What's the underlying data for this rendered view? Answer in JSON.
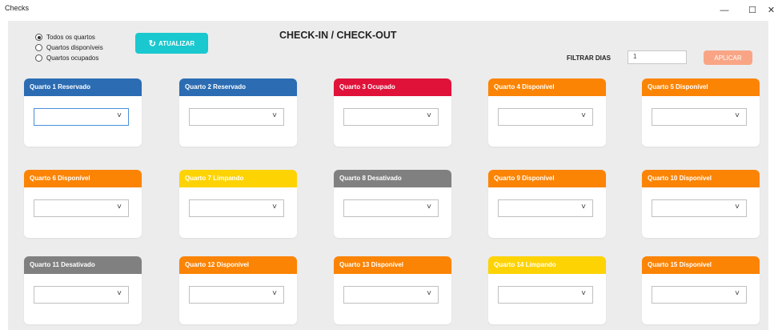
{
  "window": {
    "title": "Checks",
    "minimize": "—",
    "maximize": "☐",
    "close": "✕"
  },
  "header": {
    "title": "CHECK-IN / CHECK-OUT",
    "refresh_label": "ATUALIZAR",
    "refresh_icon": "↻",
    "filter_label": "FILTRAR DIAS",
    "filter_value": "1",
    "apply_label": "APLICAR"
  },
  "filter_options": [
    {
      "label": "Todos os quartos",
      "selected": true
    },
    {
      "label": "Quartos disponíveis",
      "selected": false
    },
    {
      "label": "Quartos ocupados",
      "selected": false
    }
  ],
  "status_colors": {
    "Reservado": "#2b6cb3",
    "Ocupado": "#e0123a",
    "Disponível": "#fb8404",
    "Limpando": "#fdd304",
    "Desativado": "#808080"
  },
  "rooms": [
    {
      "label": "Quarto 1 Reservado",
      "status": "Reservado",
      "focused": true
    },
    {
      "label": "Quarto 2 Reservado",
      "status": "Reservado"
    },
    {
      "label": "Quarto 3 Ocupado",
      "status": "Ocupado"
    },
    {
      "label": "Quarto 4 Disponível",
      "status": "Disponível"
    },
    {
      "label": "Quarto 5 Disponível",
      "status": "Disponível"
    },
    {
      "label": "Quarto 6 Disponível",
      "status": "Disponível"
    },
    {
      "label": "Quarto 7 Limpando",
      "status": "Limpando"
    },
    {
      "label": "Quarto 8 Desativado",
      "status": "Desativado"
    },
    {
      "label": "Quarto 9 Disponível",
      "status": "Disponível"
    },
    {
      "label": "Quarto 10 Disponível",
      "status": "Disponível"
    },
    {
      "label": "Quarto 11 Desativado",
      "status": "Desativado"
    },
    {
      "label": "Quarto 12 Disponível",
      "status": "Disponível"
    },
    {
      "label": "Quarto 13 Disponível",
      "status": "Disponível"
    },
    {
      "label": "Quarto 14 Limpando",
      "status": "Limpando"
    },
    {
      "label": "Quarto 15 Disponível",
      "status": "Disponível"
    }
  ],
  "select_icon": "chevron-down-icon"
}
